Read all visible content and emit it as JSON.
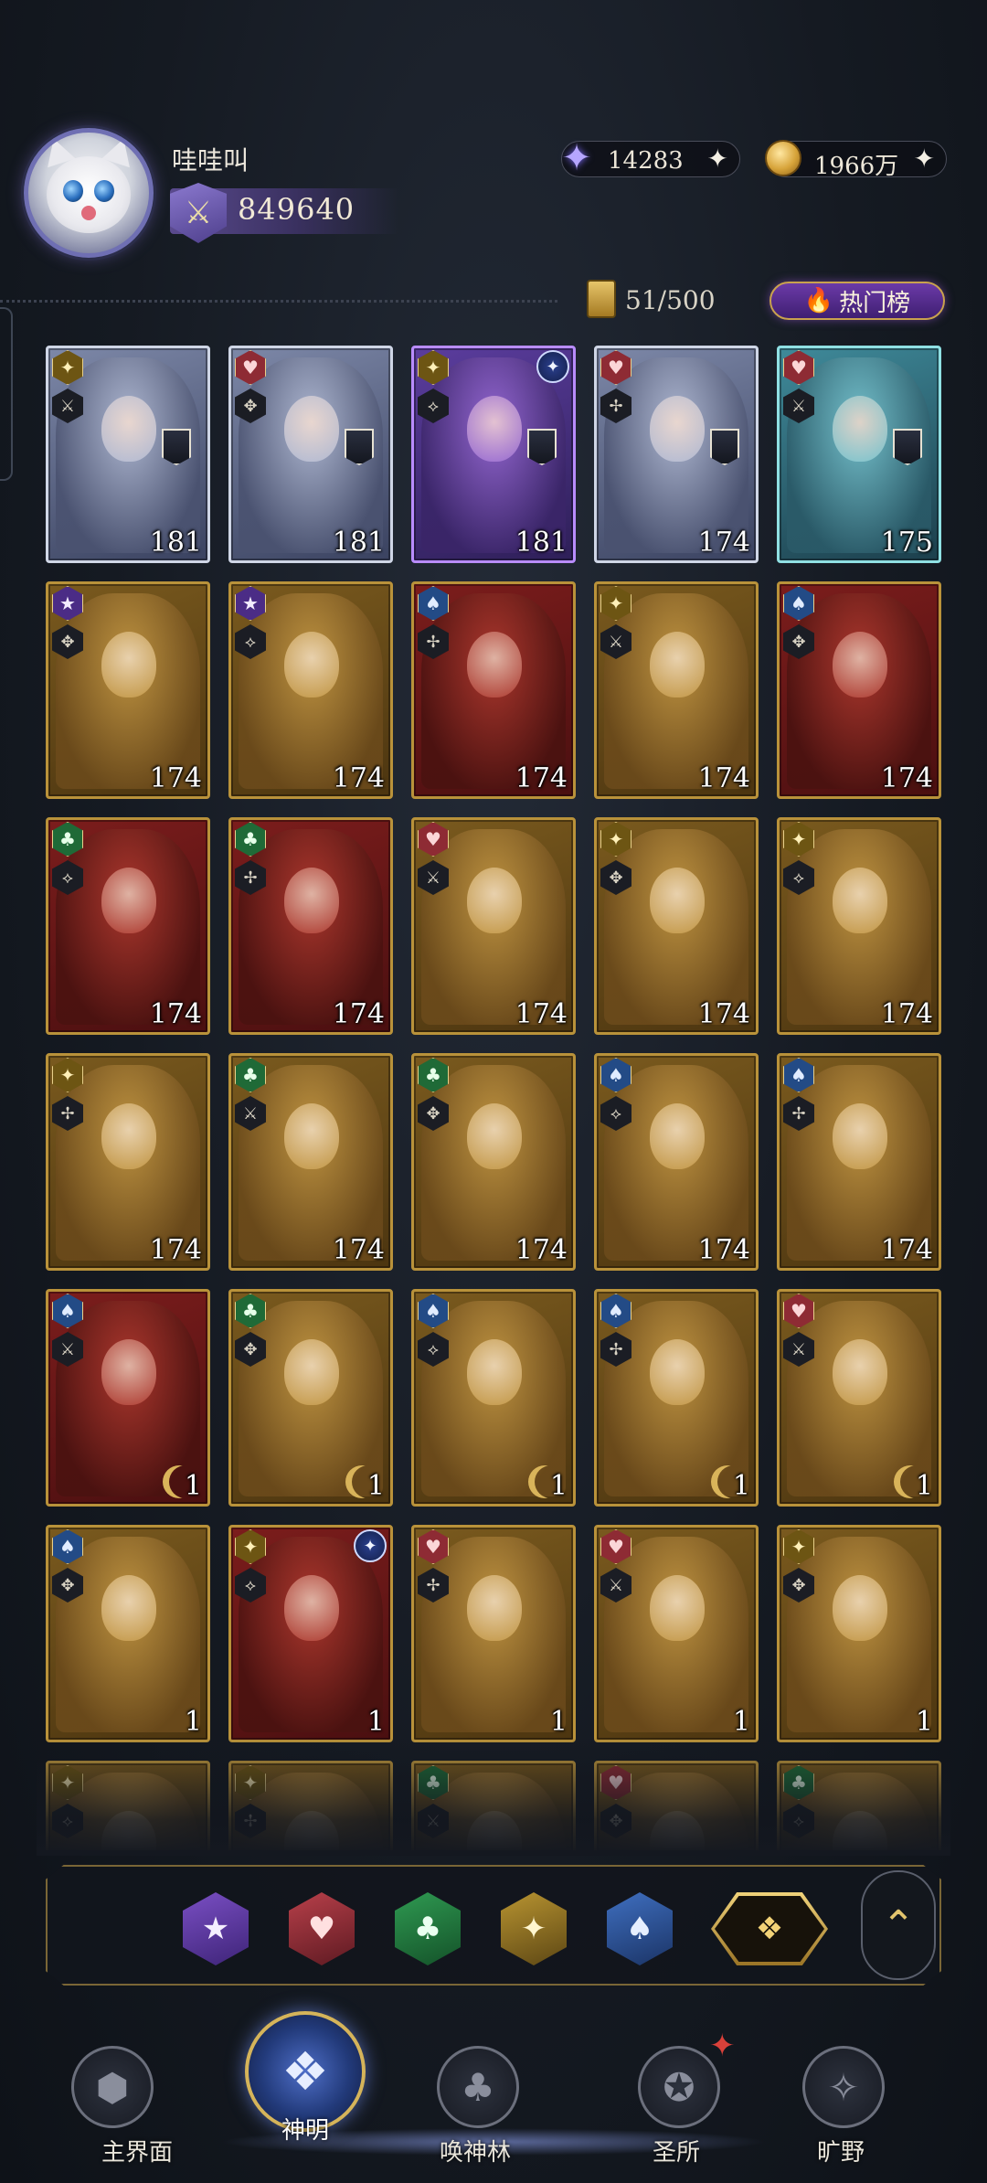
{
  "header": {
    "username": "哇哇叫",
    "power": "849640",
    "crystal": "14283",
    "gold": "1966万",
    "collection_count": "51/500",
    "hot_label": "热门榜"
  },
  "cards": [
    {
      "suit": "diamond",
      "frame": "silver",
      "level": "181",
      "badge": true
    },
    {
      "suit": "heart",
      "frame": "silver",
      "level": "181",
      "badge": true
    },
    {
      "suit": "diamond",
      "frame": "purple",
      "level": "181",
      "badge": true,
      "mark": true
    },
    {
      "suit": "heart",
      "frame": "silver",
      "level": "174",
      "badge": true
    },
    {
      "suit": "heart",
      "frame": "cyan",
      "level": "175",
      "badge": true
    },
    {
      "suit": "star",
      "frame": "gold",
      "level": "174"
    },
    {
      "suit": "star",
      "frame": "gold",
      "level": "174"
    },
    {
      "suit": "spade",
      "frame": "red",
      "level": "174"
    },
    {
      "suit": "diamond",
      "frame": "gold",
      "level": "174"
    },
    {
      "suit": "spade",
      "frame": "red",
      "level": "174"
    },
    {
      "suit": "club",
      "frame": "red",
      "level": "174"
    },
    {
      "suit": "club",
      "frame": "red",
      "level": "174"
    },
    {
      "suit": "heart",
      "frame": "gold",
      "level": "174"
    },
    {
      "suit": "diamond",
      "frame": "gold",
      "level": "174"
    },
    {
      "suit": "diamond",
      "frame": "gold",
      "level": "174"
    },
    {
      "suit": "diamond",
      "frame": "gold",
      "level": "174"
    },
    {
      "suit": "club",
      "frame": "gold",
      "level": "174"
    },
    {
      "suit": "club",
      "frame": "gold",
      "level": "174"
    },
    {
      "suit": "spade",
      "frame": "gold",
      "level": "174"
    },
    {
      "suit": "spade",
      "frame": "gold",
      "level": "174"
    },
    {
      "suit": "spade",
      "frame": "red",
      "level": "1",
      "moon": true
    },
    {
      "suit": "club",
      "frame": "gold",
      "level": "1",
      "moon": true
    },
    {
      "suit": "spade",
      "frame": "gold",
      "level": "1",
      "moon": true
    },
    {
      "suit": "spade",
      "frame": "gold",
      "level": "1",
      "moon": true
    },
    {
      "suit": "heart",
      "frame": "gold",
      "level": "1",
      "moon": true
    },
    {
      "suit": "spade",
      "frame": "gold",
      "level": "1"
    },
    {
      "suit": "diamond",
      "frame": "red",
      "level": "1",
      "mark": true
    },
    {
      "suit": "heart",
      "frame": "gold",
      "level": "1"
    },
    {
      "suit": "heart",
      "frame": "gold",
      "level": "1"
    },
    {
      "suit": "diamond",
      "frame": "gold",
      "level": "1"
    },
    {
      "suit": "diamond",
      "frame": "gold",
      "level": ""
    },
    {
      "suit": "diamond",
      "frame": "gold",
      "level": ""
    },
    {
      "suit": "club",
      "frame": "gold",
      "level": ""
    },
    {
      "suit": "heart",
      "frame": "gold",
      "level": ""
    },
    {
      "suit": "club",
      "frame": "gold",
      "level": ""
    }
  ],
  "filters": [
    "star",
    "heart",
    "club",
    "diamond",
    "spade",
    "all"
  ],
  "nav": {
    "main": "主界面",
    "god": "神明",
    "forest": "唤神林",
    "shrine": "圣所",
    "wild": "旷野"
  },
  "icons": {
    "crystal": "crystal-star-icon",
    "gold": "gold-coin-icon",
    "plus": "plus-sparkle-icon",
    "flame": "flame-icon",
    "collapse": "chevron-up-icon"
  },
  "colors": {
    "accent_gold": "#c9a24e",
    "hot_purple": "#6b3aa8"
  }
}
